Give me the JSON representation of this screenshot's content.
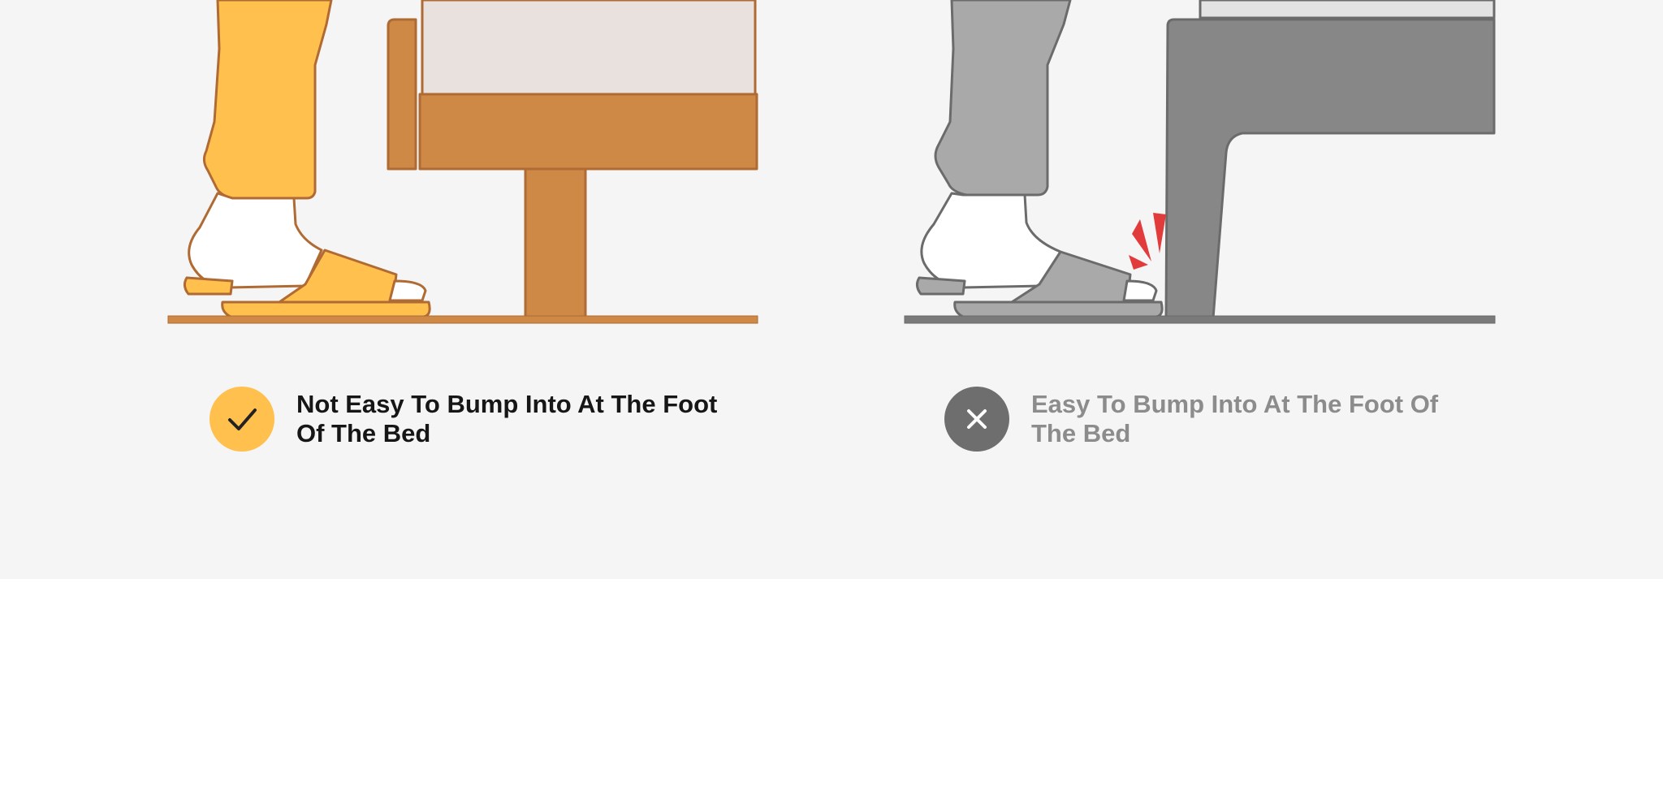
{
  "comparison": {
    "good": {
      "label": "Not Easy To Bump Into At The Foot Of The Bed",
      "icon": "check-icon",
      "accent": "#ffc04d"
    },
    "bad": {
      "label": "Easy To Bump Into At The Foot Of The Bed",
      "icon": "close-icon",
      "accent": "#6e6e6e"
    }
  },
  "colors": {
    "background": "#f5f5f5",
    "pants_yellow": "#ffc04d",
    "bed_wood": "#cd8945",
    "mattress": "#e8e1dd",
    "grey_dark": "#878787",
    "grey_light": "#a9a9a9",
    "impact_red": "#e23b3b"
  }
}
